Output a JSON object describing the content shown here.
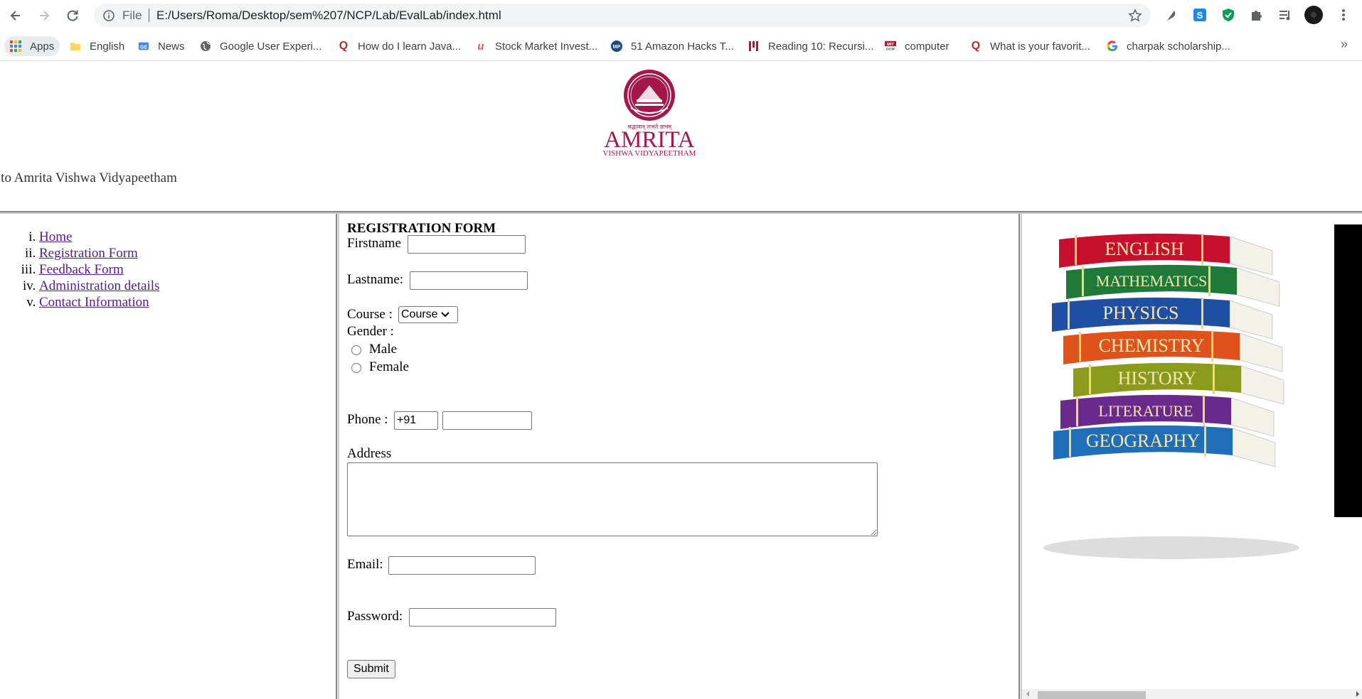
{
  "browser": {
    "url_scheme": "File",
    "url": "E:/Users/Roma/Desktop/sem%207/NCP/Lab/EvalLab/index.html",
    "bookmarks": [
      {
        "label": "Apps",
        "icon": "apps-grid-icon"
      },
      {
        "label": "English",
        "icon": "folder-icon"
      },
      {
        "label": "News",
        "icon": "google-news-icon"
      },
      {
        "label": "Google User Experi...",
        "icon": "globe-icon"
      },
      {
        "label": "How do I learn Java...",
        "icon": "quora-icon"
      },
      {
        "label": "Stock Market Invest...",
        "icon": "udemy-icon"
      },
      {
        "label": "51 Amazon Hacks T...",
        "icon": "mp-icon"
      },
      {
        "label": "Reading 10: Recursi...",
        "icon": "mit-icon"
      },
      {
        "label": "computer",
        "icon": "mit-ocw-icon"
      },
      {
        "label": "What is your favorit...",
        "icon": "quora-icon"
      },
      {
        "label": "charpak scholarship...",
        "icon": "google-icon"
      }
    ],
    "more_bookmarks": "»"
  },
  "header": {
    "logo_tagline": "श्रद्धावान् लभते ज्ञानम्",
    "logo_name": "AMRITA",
    "logo_sub": "VISHWA VIDYAPEETHAM",
    "marquee_text": "e to Amrita Vishwa Vidyapeetham"
  },
  "menu": {
    "items": [
      "Home",
      "Registration Form",
      "Feedback Form",
      "Administration details",
      "Contact Information"
    ]
  },
  "form": {
    "title": "REGISTRATION FORM",
    "firstname_label": "Firstname",
    "lastname_label": "Lastname:",
    "course_label": "Course :",
    "course_selected": "Course",
    "gender_label": "Gender :",
    "gender_options": [
      "Male",
      "Female"
    ],
    "phone_label": "Phone :",
    "phone_code": "+91",
    "address_label": "Address",
    "email_label": "Email:",
    "password_label": "Password:",
    "submit_label": "Submit"
  },
  "books": {
    "spines": [
      "ENGLISH",
      "MATHEMATICS",
      "PHYSICS",
      "CHEMISTRY",
      "HISTORY",
      "LITERATURE",
      "GEOGRAPHY"
    ],
    "colors": [
      "#c8102e",
      "#1f7a3a",
      "#1e4fa3",
      "#e0521b",
      "#8a9a1a",
      "#6a2a8c",
      "#1f6fb8"
    ]
  },
  "colors": {
    "brand": "#a3174b",
    "link": "#551a8b"
  }
}
